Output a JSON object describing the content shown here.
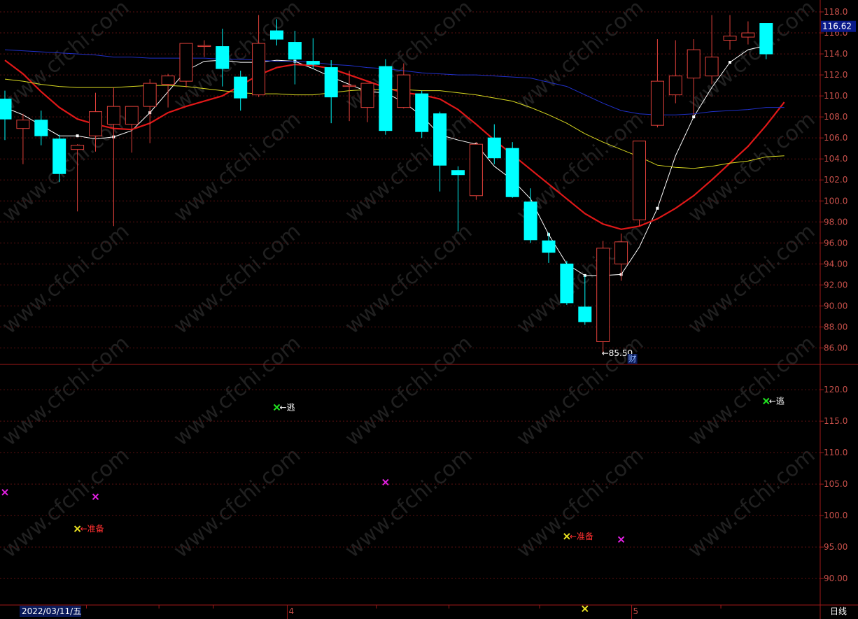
{
  "chart_data": [
    {
      "type": "candlestick",
      "ylim": [
        84.5,
        118.6
      ],
      "y_ticks": [
        "118.0",
        "116.0",
        "114.0",
        "112.0",
        "110.0",
        "108.0",
        "106.0",
        "104.0",
        "102.0",
        "100.0",
        "98.00",
        "96.00",
        "94.00",
        "92.00",
        "90.00",
        "88.00",
        "86.00"
      ],
      "last_price_label": "116.62",
      "low_annotation": "←85.50",
      "low_annotation_value": 85.5,
      "event_marker": "财",
      "candles": [
        {
          "o": 109.7,
          "h": 110.5,
          "l": 105.8,
          "c": 107.8
        },
        {
          "o": 106.9,
          "h": 108.3,
          "l": 103.5,
          "c": 107.7
        },
        {
          "o": 107.7,
          "h": 108.6,
          "l": 105.3,
          "c": 106.2
        },
        {
          "o": 105.9,
          "h": 106.3,
          "l": 101.8,
          "c": 102.6
        },
        {
          "o": 104.9,
          "h": 105.4,
          "l": 99.0,
          "c": 105.3
        },
        {
          "o": 106.2,
          "h": 110.3,
          "l": 104.7,
          "c": 108.5
        },
        {
          "o": 107.3,
          "h": 110.8,
          "l": 97.6,
          "c": 109.0
        },
        {
          "o": 107.3,
          "h": 109.0,
          "l": 104.6,
          "c": 109.0
        },
        {
          "o": 109.0,
          "h": 111.6,
          "l": 105.5,
          "c": 111.2
        },
        {
          "o": 111.1,
          "h": 112.1,
          "l": 108.9,
          "c": 111.9
        },
        {
          "o": 111.4,
          "h": 115.0,
          "l": 110.8,
          "c": 115.0
        },
        {
          "o": 114.7,
          "h": 115.3,
          "l": 113.7,
          "c": 114.8
        },
        {
          "o": 114.7,
          "h": 116.4,
          "l": 110.9,
          "c": 112.6
        },
        {
          "o": 111.8,
          "h": 112.4,
          "l": 108.6,
          "c": 109.8
        },
        {
          "o": 110.1,
          "h": 117.7,
          "l": 109.9,
          "c": 115.0
        },
        {
          "o": 116.2,
          "h": 117.3,
          "l": 114.8,
          "c": 115.4
        },
        {
          "o": 115.1,
          "h": 116.2,
          "l": 111.1,
          "c": 113.5
        },
        {
          "o": 113.3,
          "h": 115.5,
          "l": 112.6,
          "c": 113.0
        },
        {
          "o": 112.7,
          "h": 113.4,
          "l": 107.4,
          "c": 109.9
        },
        {
          "o": 111.0,
          "h": 112.4,
          "l": 107.6,
          "c": 111.0
        },
        {
          "o": 108.9,
          "h": 110.9,
          "l": 107.5,
          "c": 111.2
        },
        {
          "o": 112.8,
          "h": 113.5,
          "l": 106.3,
          "c": 106.7
        },
        {
          "o": 108.9,
          "h": 113.1,
          "l": 108.8,
          "c": 112.0
        },
        {
          "o": 110.2,
          "h": 110.5,
          "l": 106.0,
          "c": 106.6
        },
        {
          "o": 108.3,
          "h": 108.5,
          "l": 100.9,
          "c": 103.4
        },
        {
          "o": 102.9,
          "h": 103.3,
          "l": 97.1,
          "c": 102.5
        },
        {
          "o": 100.5,
          "h": 105.6,
          "l": 100.1,
          "c": 105.4
        },
        {
          "o": 106.0,
          "h": 107.3,
          "l": 103.5,
          "c": 104.1
        },
        {
          "o": 105.0,
          "h": 105.6,
          "l": 100.3,
          "c": 100.4
        },
        {
          "o": 99.9,
          "h": 101.2,
          "l": 96.0,
          "c": 96.3
        },
        {
          "o": 96.2,
          "h": 97.0,
          "l": 94.1,
          "c": 95.1
        },
        {
          "o": 94.0,
          "h": 94.3,
          "l": 90.1,
          "c": 90.3
        },
        {
          "o": 89.9,
          "h": 92.9,
          "l": 88.2,
          "c": 88.5
        },
        {
          "o": 86.6,
          "h": 96.2,
          "l": 85.5,
          "c": 95.5
        },
        {
          "o": 94.0,
          "h": 96.9,
          "l": 92.4,
          "c": 96.1
        },
        {
          "o": 98.2,
          "h": 105.7,
          "l": 97.6,
          "c": 105.7
        },
        {
          "o": 107.2,
          "h": 115.4,
          "l": 107.0,
          "c": 111.4
        },
        {
          "o": 110.1,
          "h": 115.3,
          "l": 109.3,
          "c": 111.9
        },
        {
          "o": 111.7,
          "h": 115.4,
          "l": 108.2,
          "c": 114.4
        },
        {
          "o": 111.9,
          "h": 117.7,
          "l": 111.1,
          "c": 113.7
        },
        {
          "o": 115.3,
          "h": 117.7,
          "l": 114.4,
          "c": 115.7
        },
        {
          "o": 115.6,
          "h": 117.1,
          "l": 114.9,
          "c": 116.0
        },
        {
          "o": 116.9,
          "h": 116.9,
          "l": 113.5,
          "c": 114.0
        }
      ],
      "series": [
        {
          "color": "#ffffff",
          "values": [
            108.9,
            108.2,
            107.2,
            106.2,
            106.2,
            105.9,
            106.1,
            106.7,
            108.4,
            110.4,
            112.4,
            113.3,
            113.4,
            113.2,
            113.2,
            113.4,
            113.3,
            112.6,
            111.8,
            111.1,
            110.4,
            110.3,
            109.4,
            108.1,
            106.3,
            105.8,
            105.4,
            103.3,
            102.0,
            100.2,
            96.8,
            94.0,
            92.9,
            92.9,
            93.0,
            95.6,
            99.3,
            104.3,
            108.0,
            110.8,
            113.2,
            114.4,
            114.8
          ]
        },
        {
          "color": "#e01818",
          "values": [
            113.4,
            112.1,
            110.4,
            108.9,
            107.8,
            107.3,
            106.9,
            106.8,
            107.4,
            108.4,
            109.0,
            109.5,
            110.0,
            111.0,
            112.0,
            112.7,
            113.0,
            112.9,
            112.6,
            112.0,
            111.4,
            110.8,
            110.3,
            110.1,
            109.7,
            108.7,
            107.3,
            105.8,
            104.4,
            103.0,
            101.6,
            100.2,
            98.8,
            97.8,
            97.3,
            97.6,
            98.3,
            99.3,
            100.5,
            102.0,
            103.6,
            105.2,
            107.2,
            109.4
          ]
        },
        {
          "color": "#d8d820",
          "values": [
            111.6,
            111.4,
            111.1,
            110.9,
            110.8,
            110.8,
            110.8,
            110.9,
            111.0,
            111.0,
            110.9,
            110.7,
            110.5,
            110.3,
            110.2,
            110.2,
            110.1,
            110.1,
            110.3,
            110.5,
            110.6,
            110.6,
            110.6,
            110.5,
            110.5,
            110.3,
            110.1,
            109.8,
            109.5,
            108.9,
            108.2,
            107.4,
            106.4,
            105.6,
            104.9,
            104.2,
            103.4,
            103.2,
            103.1,
            103.3,
            103.6,
            103.8,
            104.2,
            104.3
          ]
        },
        {
          "color": "#2030c8",
          "values": [
            114.4,
            114.3,
            114.2,
            114.1,
            114.0,
            113.9,
            113.7,
            113.7,
            113.6,
            113.6,
            113.6,
            113.6,
            113.5,
            113.5,
            113.4,
            113.3,
            113.3,
            113.2,
            113.0,
            112.9,
            112.7,
            112.6,
            112.4,
            112.2,
            112.1,
            112.0,
            112.0,
            111.9,
            111.8,
            111.7,
            111.3,
            110.9,
            110.1,
            109.3,
            108.6,
            108.3,
            108.2,
            108.2,
            108.3,
            108.5,
            108.6,
            108.7,
            108.9,
            108.9
          ]
        }
      ]
    },
    {
      "type": "scatter",
      "ylim": [
        85.9,
        123.8
      ],
      "y_ticks": [
        "120.0",
        "115.0",
        "110.0",
        "105.0",
        "100.0",
        "95.00",
        "90.00"
      ],
      "points": [
        {
          "i": 0,
          "y": 103.7,
          "color": "#e020e0",
          "label": ""
        },
        {
          "i": 4,
          "y": 97.9,
          "color": "#e8e020",
          "label": "←准备"
        },
        {
          "i": 5,
          "y": 103.0,
          "color": "#e020e0",
          "label": ""
        },
        {
          "i": 15,
          "y": 117.2,
          "color": "#20e020",
          "label": "←逃"
        },
        {
          "i": 21,
          "y": 105.3,
          "color": "#e020e0",
          "label": ""
        },
        {
          "i": 31,
          "y": 96.7,
          "color": "#e8e020",
          "label": "←准备"
        },
        {
          "i": 32,
          "y": 85.2,
          "color": "#e8e020",
          "label": ""
        },
        {
          "i": 34,
          "y": 96.2,
          "color": "#e020e0",
          "label": ""
        },
        {
          "i": 42,
          "y": 118.2,
          "color": "#20e020",
          "label": "←逃"
        }
      ]
    }
  ],
  "footer": {
    "date_label": "2022/03/11/五",
    "month_marks": [
      "4",
      "5"
    ],
    "period_label": "日线"
  },
  "watermark": "www.cfchi.com",
  "colors": {
    "bull": "#e0403a",
    "bear": "#00ffff",
    "axis": "#a01818",
    "grid": "#5a1010",
    "tick_text": "#c8504a"
  }
}
